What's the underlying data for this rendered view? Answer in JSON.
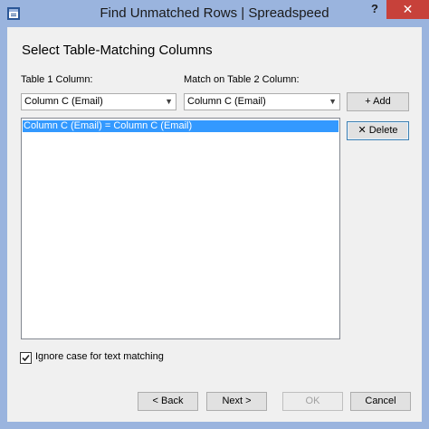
{
  "window": {
    "title": "Find Unmatched Rows  |  Spreadspeed",
    "help_label": "?",
    "close_label": "✕"
  },
  "page": {
    "heading": "Select Table-Matching Columns"
  },
  "table1": {
    "label": "Table 1 Column:",
    "selected": "Column C (Email)"
  },
  "table2": {
    "label": "Match on Table 2 Column:",
    "selected": "Column C (Email)"
  },
  "buttons": {
    "add": "+ Add",
    "delete": "✕ Delete",
    "back": "< Back",
    "next": "Next >",
    "ok": "OK",
    "cancel": "Cancel"
  },
  "matches": [
    "Column C (Email) = Column C (Email)"
  ],
  "options": {
    "ignore_case_label": "Ignore case for text matching",
    "ignore_case_checked": true
  },
  "colors": {
    "titlebar": "#9ab4de",
    "close": "#c7413a",
    "selection": "#3399ff"
  }
}
